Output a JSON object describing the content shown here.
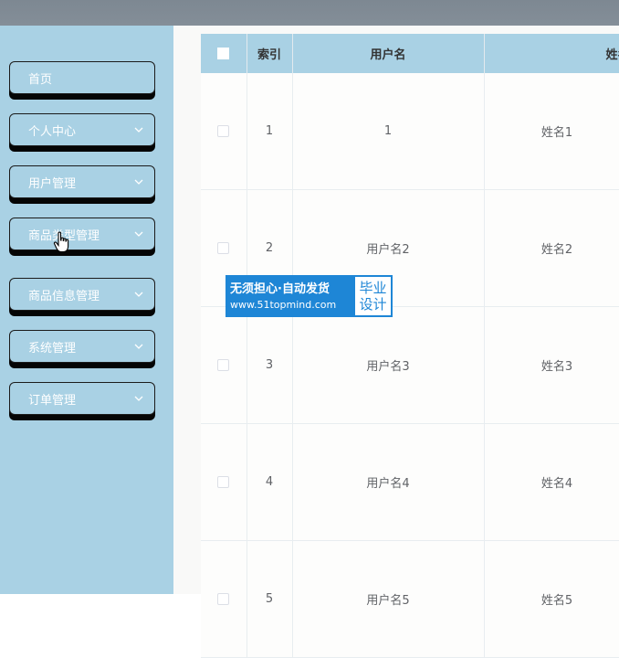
{
  "sidebar": {
    "items": [
      {
        "label": "首页",
        "has_arrow": false
      },
      {
        "label": "个人中心",
        "has_arrow": true
      },
      {
        "label": "用户管理",
        "has_arrow": true
      },
      {
        "label": "商品类型管理",
        "has_arrow": true
      },
      {
        "label": "商品信息管理",
        "has_arrow": true
      },
      {
        "label": "系统管理",
        "has_arrow": true
      },
      {
        "label": "订单管理",
        "has_arrow": true
      }
    ],
    "arrow_icon": "chevron-down-icon"
  },
  "table": {
    "columns": {
      "index": "索引",
      "username": "用户名",
      "name": "姓名"
    },
    "rows": [
      {
        "index": "1",
        "username": "1",
        "name": "姓名1"
      },
      {
        "index": "2",
        "username": "用户名2",
        "name": "姓名2"
      },
      {
        "index": "3",
        "username": "用户名3",
        "name": "姓名3"
      },
      {
        "index": "4",
        "username": "用户名4",
        "name": "姓名4"
      },
      {
        "index": "5",
        "username": "用户名5",
        "name": "姓名5"
      }
    ]
  },
  "watermark": {
    "line1": "无须担心·自动发货",
    "line2": "www.51topmind.com",
    "badge_line1": "毕业",
    "badge_line2": "设计"
  },
  "colors": {
    "sidebar_bg": "#a9d1e4",
    "topbar_bg": "#808a94",
    "watermark_blue": "#1e86d6"
  }
}
